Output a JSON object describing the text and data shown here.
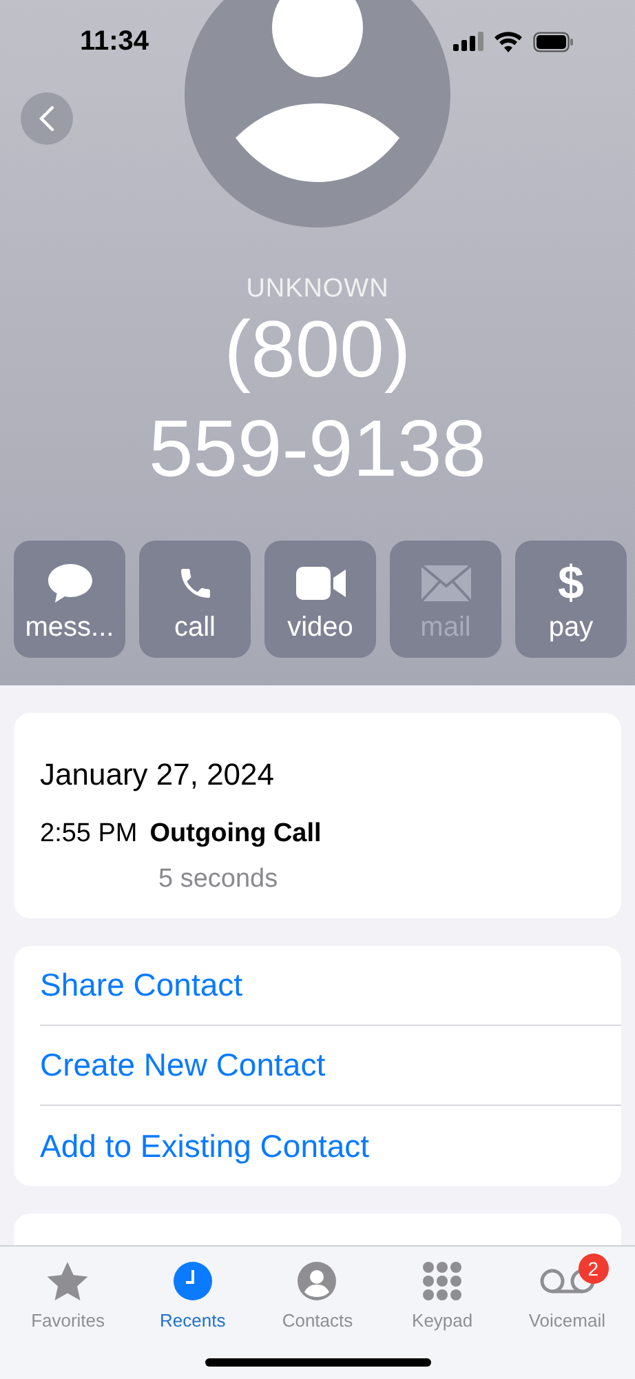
{
  "status_bar": {
    "time": "11:34"
  },
  "contact": {
    "label": "UNKNOWN",
    "number_lines": [
      "(800)",
      "559-9138"
    ]
  },
  "actions": [
    {
      "kind": "message",
      "label": "mess...",
      "disabled": false
    },
    {
      "kind": "call",
      "label": "call",
      "disabled": false
    },
    {
      "kind": "video",
      "label": "video",
      "disabled": false
    },
    {
      "kind": "mail",
      "label": "mail",
      "disabled": true
    },
    {
      "kind": "pay",
      "label": "pay",
      "disabled": false,
      "glyph": "$"
    }
  ],
  "call_log": {
    "date": "January 27, 2024",
    "entries": [
      {
        "time": "2:55 PM",
        "type": "Outgoing Call",
        "duration": "5 seconds"
      }
    ]
  },
  "options": [
    "Share Contact",
    "Create New Contact",
    "Add to Existing Contact"
  ],
  "tab_bar": [
    {
      "kind": "favorites",
      "label": "Favorites",
      "selected": false
    },
    {
      "kind": "recents",
      "label": "Recents",
      "selected": true
    },
    {
      "kind": "contacts",
      "label": "Contacts",
      "selected": false
    },
    {
      "kind": "keypad",
      "label": "Keypad",
      "selected": false
    },
    {
      "kind": "voicemail",
      "label": "Voicemail",
      "selected": false,
      "badge": "2"
    }
  ]
}
